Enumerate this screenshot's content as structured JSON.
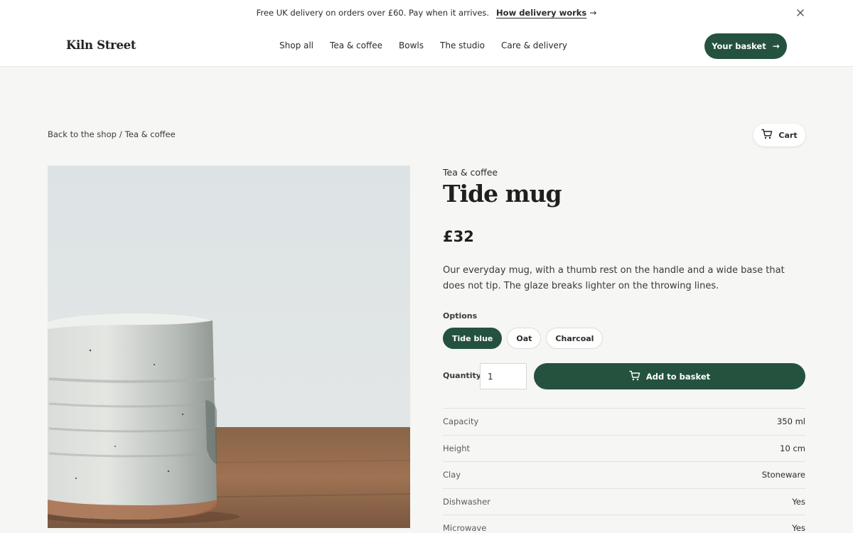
{
  "announcement": {
    "message": "Free UK delivery on orders over £60. Pay when it arrives.",
    "link": "How delivery works",
    "link_arrow": "→"
  },
  "header": {
    "logo": "Kiln Street",
    "nav": [
      "Shop all",
      "Tea & coffee",
      "Bowls",
      "The studio",
      "Care & delivery"
    ],
    "basket_label": "Your basket",
    "basket_arrow": "→"
  },
  "breadcrumb": {
    "back": "Back to the shop",
    "separator": "/",
    "current": "Tea & coffee"
  },
  "cart": {
    "label": "Cart"
  },
  "product": {
    "category": "Tea & coffee",
    "title": "Tide mug",
    "price": "£32",
    "description": "Our everyday mug, with a thumb rest on the handle and a wide base that does not tip. The glaze breaks lighter on the throwing lines.",
    "options_label": "Options",
    "options": [
      {
        "label": "Tide blue",
        "selected": true
      },
      {
        "label": "Oat",
        "selected": false
      },
      {
        "label": "Charcoal",
        "selected": false
      }
    ],
    "quantity_label": "Quantity",
    "quantity_value": "1",
    "add_label": "Add to basket"
  },
  "specs": [
    {
      "key": "Capacity",
      "value": "350 ml"
    },
    {
      "key": "Height",
      "value": "10 cm"
    },
    {
      "key": "Clay",
      "value": "Stoneware"
    },
    {
      "key": "Dishwasher",
      "value": "Yes"
    },
    {
      "key": "Microwave",
      "value": "Yes"
    }
  ],
  "colors": {
    "accent": "#24523f",
    "background": "#f6f6f4"
  },
  "icons": {
    "close": "close-icon",
    "cart": "cart-icon",
    "arrow": "arrow-right-icon"
  }
}
